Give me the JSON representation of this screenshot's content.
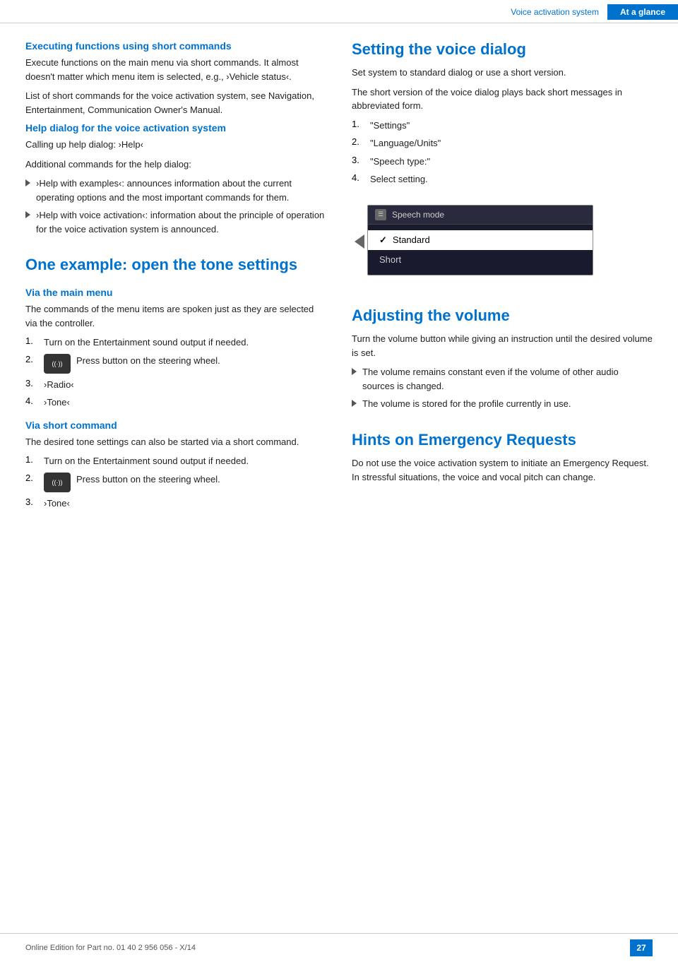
{
  "header": {
    "section_label": "Voice activation system",
    "current_label": "At a glance"
  },
  "left_col": {
    "section1_heading": "Executing functions using short commands",
    "section1_p1": "Execute functions on the main menu via short commands. It almost doesn't matter which menu item is selected, e.g., ›Vehicle status‹.",
    "section1_p2": "List of short commands for the voice activation system, see Navigation, Entertainment, Communication Owner's Manual.",
    "section2_heading": "Help dialog for the voice activation system",
    "section2_p1": "Calling up help dialog: ›Help‹",
    "section2_p2": "Additional commands for the help dialog:",
    "section2_bullet1": "›Help with examples‹: announces information about the current operating options and the most important commands for them.",
    "section2_bullet2": "›Help with voice activation‹: information about the principle of operation for the voice activation system is announced.",
    "section3_large_heading": "One example: open the tone settings",
    "section3_sub1": "Via the main menu",
    "section3_sub1_p1": "The commands of the menu items are spoken just as they are selected via the controller.",
    "section3_steps_via_main": [
      {
        "num": "1.",
        "text": "Turn on the Entertainment sound output if needed."
      },
      {
        "num": "2.",
        "text": "Press button on the steering wheel.",
        "has_icon": true
      },
      {
        "num": "3.",
        "text": "›Radio‹"
      },
      {
        "num": "4.",
        "text": "›Tone‹"
      }
    ],
    "section3_sub2": "Via short command",
    "section3_sub2_p1": "The desired tone settings can also be started via a short command.",
    "section3_steps_via_short": [
      {
        "num": "1.",
        "text": "Turn on the Entertainment sound output if needed."
      },
      {
        "num": "2.",
        "text": "Press button on the steering wheel.",
        "has_icon": true
      },
      {
        "num": "3.",
        "text": "›Tone‹"
      }
    ]
  },
  "right_col": {
    "section1_large_heading": "Setting the voice dialog",
    "section1_p1": "Set system to standard dialog or use a short version.",
    "section1_p2": "The short version of the voice dialog plays back short messages in abbreviated form.",
    "section1_steps": [
      {
        "num": "1.",
        "text": "\"Settings\""
      },
      {
        "num": "2.",
        "text": "\"Language/Units\""
      },
      {
        "num": "3.",
        "text": "\"Speech type:\""
      },
      {
        "num": "4.",
        "text": "Select setting."
      }
    ],
    "speech_mode_title": "Speech mode",
    "speech_option_standard": "Standard",
    "speech_option_short": "Short",
    "section2_large_heading": "Adjusting the volume",
    "section2_p1": "Turn the volume button while giving an instruction until the desired volume is set.",
    "section2_bullet1": "The volume remains constant even if the volume of other audio sources is changed.",
    "section2_bullet2": "The volume is stored for the profile currently in use.",
    "section3_large_heading": "Hints on Emergency Requests",
    "section3_p1": "Do not use the voice activation system to initiate an Emergency Request. In stressful situations, the voice and vocal pitch can change."
  },
  "footer": {
    "text": "Online Edition for Part no. 01 40 2 956 056 - X/14",
    "page": "27"
  }
}
